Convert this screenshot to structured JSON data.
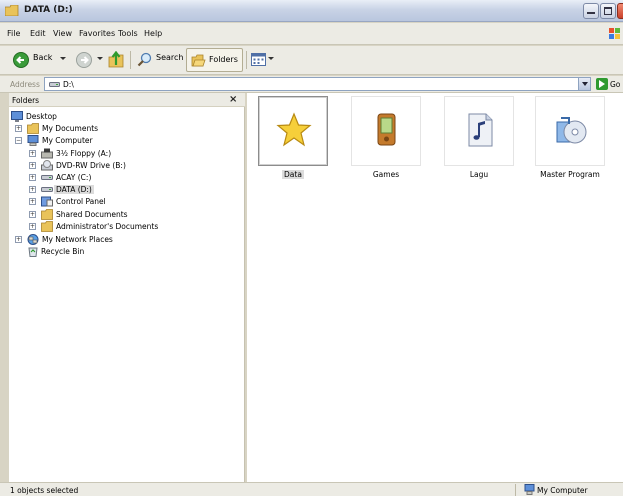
{
  "window": {
    "title": "DATA (D:)"
  },
  "menu": [
    "File",
    "Edit",
    "View",
    "Favorites",
    "Tools",
    "Help"
  ],
  "toolbar": {
    "back_label": "Back",
    "search_label": "Search",
    "folders_label": "Folders"
  },
  "address": {
    "label": "Address",
    "value": "D:\\",
    "go_label": "Go"
  },
  "folders_panel": {
    "title": "Folders",
    "close_glyph": "×",
    "tree": [
      {
        "label": "Desktop",
        "icon": "desktop-icon",
        "expander": ""
      },
      {
        "label": "My Documents",
        "icon": "folder-icon",
        "expander": "+"
      },
      {
        "label": "My Computer",
        "icon": "computer-icon",
        "expander": "−"
      },
      {
        "label": "3½ Floppy (A:)",
        "icon": "floppy-icon",
        "expander": "+"
      },
      {
        "label": "DVD-RW Drive (B:)",
        "icon": "dvd-icon",
        "expander": "+"
      },
      {
        "label": "ACAY (C:)",
        "icon": "drive-icon",
        "expander": "+"
      },
      {
        "label": "DATA (D:)",
        "icon": "drive-icon",
        "expander": "+",
        "selected": true
      },
      {
        "label": "Control Panel",
        "icon": "control-panel-icon",
        "expander": "+"
      },
      {
        "label": "Shared Documents",
        "icon": "folder-icon",
        "expander": "+"
      },
      {
        "label": "Administrator's Documents",
        "icon": "folder-icon",
        "expander": "+"
      },
      {
        "label": "My Network Places",
        "icon": "network-icon",
        "expander": "+"
      },
      {
        "label": "Recycle Bin",
        "icon": "recycle-bin-icon",
        "expander": ""
      }
    ]
  },
  "content": {
    "items": [
      {
        "label": "Data",
        "icon": "star-folder-icon",
        "selected": true
      },
      {
        "label": "Games",
        "icon": "pda-icon"
      },
      {
        "label": "Lagu",
        "icon": "music-file-icon"
      },
      {
        "label": "Master Program",
        "icon": "cd-program-icon"
      }
    ]
  },
  "status": {
    "left": "1 objects selected",
    "right": "My Computer"
  },
  "colors": {
    "chrome": "#ecebe4",
    "titlebar": "#c9d3e6",
    "selection": "#dcdcdc",
    "go_green": "#2f9a2f"
  }
}
